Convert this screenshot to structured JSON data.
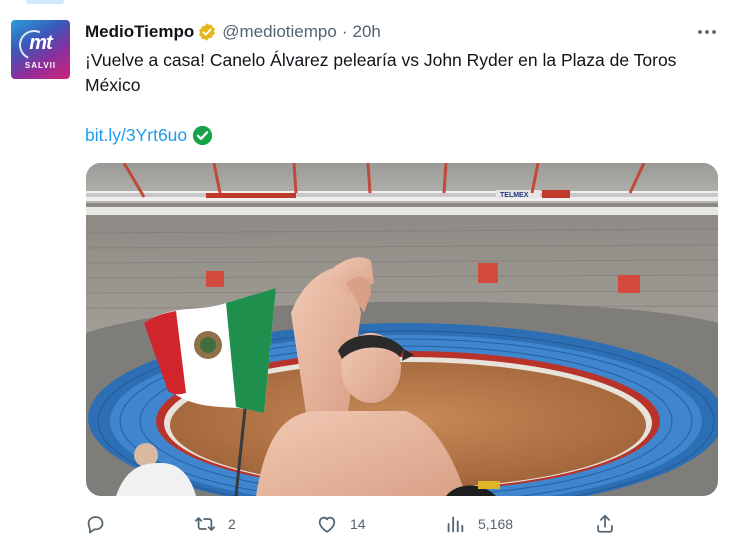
{
  "post": {
    "author_name": "MedioTiempo",
    "author_handle": "@mediotiempo",
    "separator": "·",
    "timestamp": "20h",
    "text": "¡Vuelve a casa! Canelo Álvarez pelearía vs John Ryder en la Plaza de Toros México",
    "link": "bit.ly/3Yrt6uo",
    "avatar_text": "mt",
    "avatar_subtext": "SALVII"
  },
  "media": {
    "banner_text": "TELMEX"
  },
  "actions": {
    "replies": "",
    "reposts": "2",
    "likes": "14",
    "views": "5,168"
  },
  "colors": {
    "accent": "#1d9bf0",
    "muted": "#536471",
    "verified_gold": "#e2b719"
  },
  "icons": [
    "more-icon",
    "verified-badge-icon",
    "link-verified-icon",
    "reply-icon",
    "repost-icon",
    "like-icon",
    "views-icon",
    "share-icon"
  ]
}
